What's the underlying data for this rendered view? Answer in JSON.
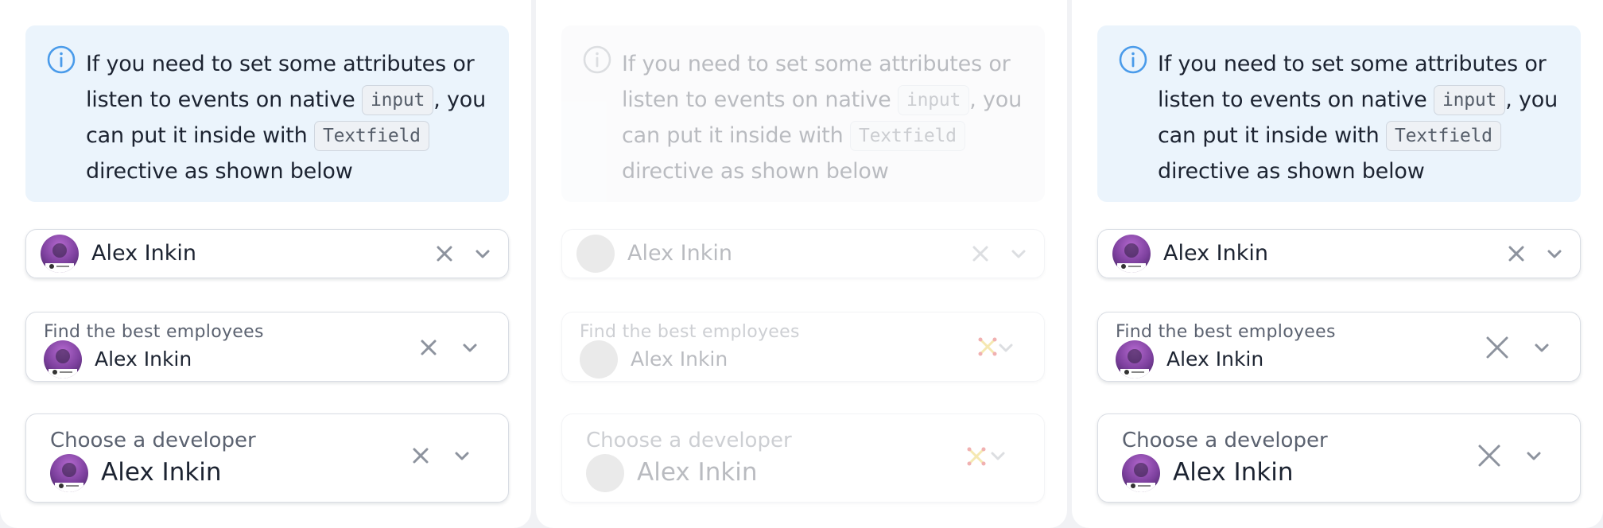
{
  "info": {
    "text_before": "If you need to set some attributes or listen to events on native",
    "code_input": "input",
    "text_middle": ", you can put it inside with",
    "code_textfield": "Textfield",
    "text_after": "directive as shown below"
  },
  "field_plain": {
    "value": "Alex Inkin"
  },
  "field_label": {
    "label": "Find the best employees",
    "value": "Alex Inkin"
  },
  "field_developer": {
    "label": "Choose a developer",
    "value": "Alex Inkin"
  },
  "colors": {
    "info_bg": "#ebf4fc",
    "info_icon": "#4a9bea",
    "icon_gray": "#8d939e"
  }
}
